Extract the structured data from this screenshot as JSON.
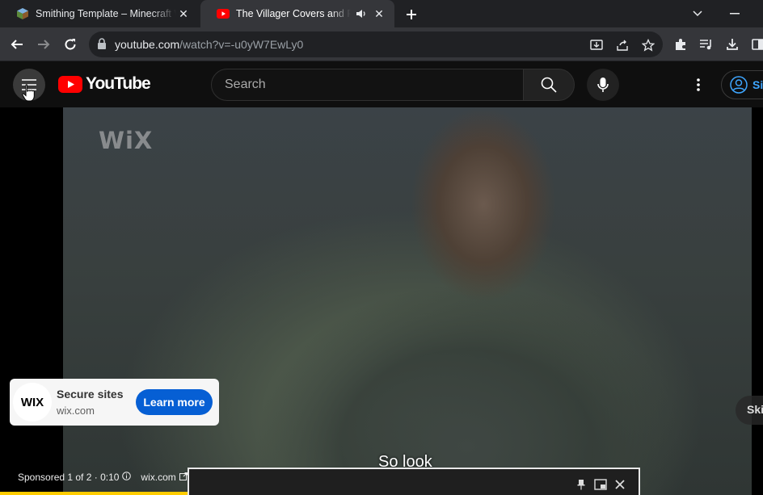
{
  "browser": {
    "tabs": [
      {
        "title": "Smithing Template – Minecraft Wiki",
        "active": false,
        "favicon": "minecraft-wiki-icon"
      },
      {
        "title": "The Villager Covers and FOR",
        "active": true,
        "favicon": "youtube-icon",
        "playing_audio": true
      }
    ],
    "url_host": "youtube.com",
    "url_path": "/watch?v=-u0yW7EwLy0"
  },
  "masthead": {
    "logo_text": "YouTube",
    "search_placeholder": "Search",
    "signin_label": "Si"
  },
  "player": {
    "watermark": "WiX",
    "ad_card": {
      "logo_text": "WIX",
      "title": "Secure sites",
      "domain": "wix.com",
      "cta": "Learn more"
    },
    "skip_label": "Ski",
    "caption": "So look",
    "ad_info": {
      "sponsored": "Sponsored 1 of 2 · 0:10",
      "domain": "wix.com"
    },
    "progress_fraction": 0.42
  },
  "colors": {
    "youtube_red": "#ff0000",
    "cta_blue": "#065fd4",
    "ad_progress": "#ffcc00",
    "signin_blue": "#3ea6ff"
  }
}
